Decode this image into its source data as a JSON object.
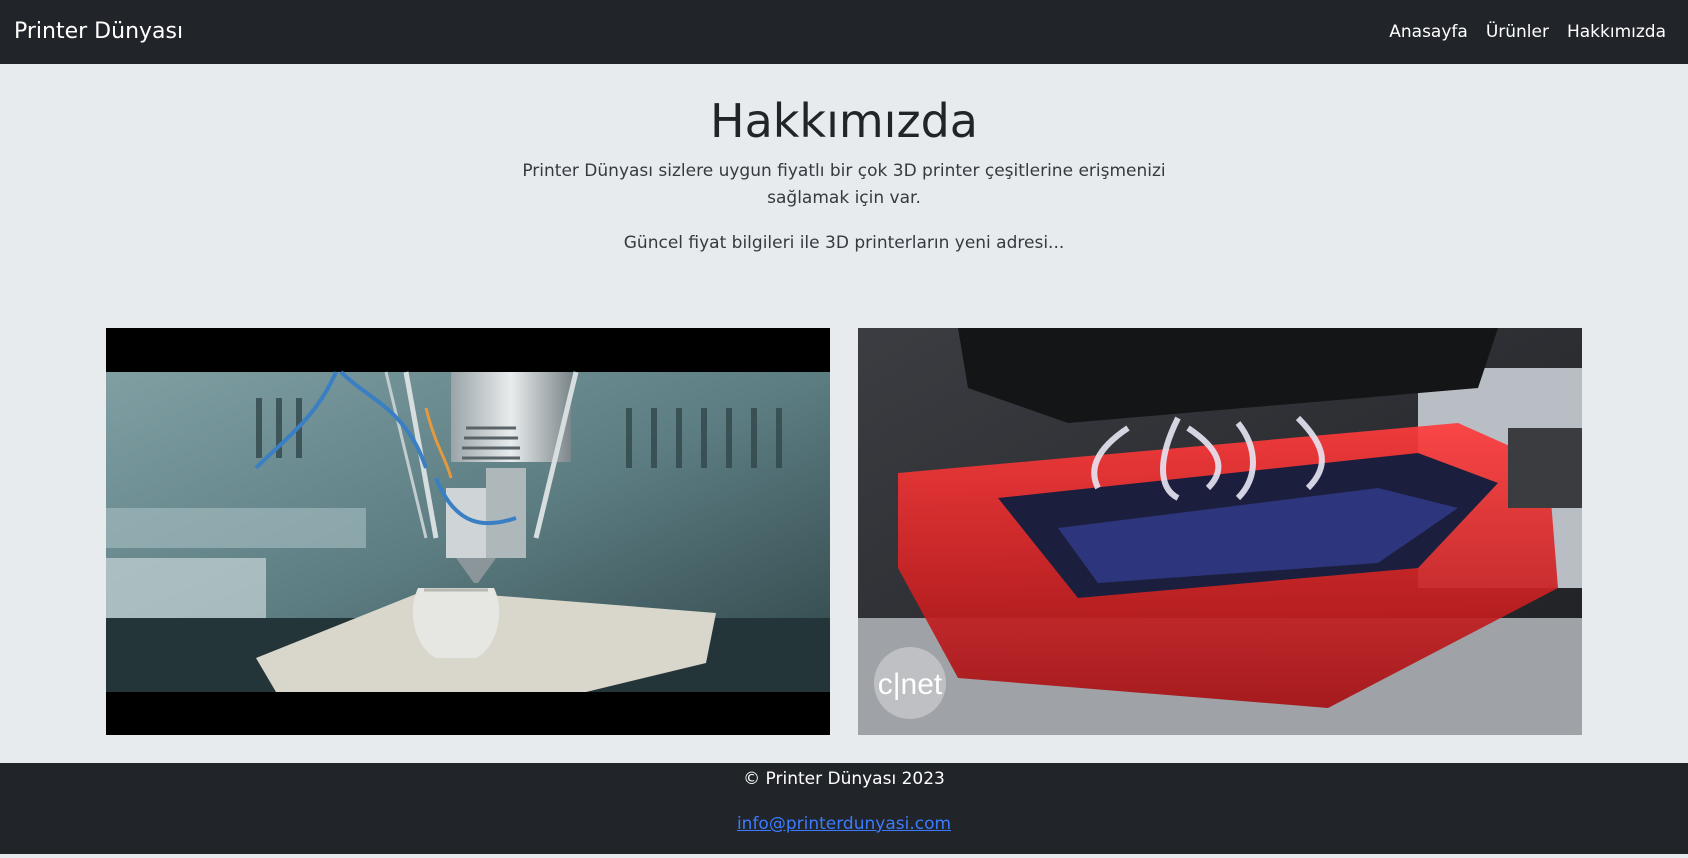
{
  "navbar": {
    "brand": "Printer Dünyası",
    "links": [
      "Anasayfa",
      "Ürünler",
      "Hakkımızda"
    ]
  },
  "about": {
    "title": "Hakkımızda",
    "description": "Printer Dünyası sizlere uygun fiyatlı bir çok 3D printer çeşitlerine erişmenizi sağlamak için var.",
    "subtitle": "Güncel fiyat bilgileri ile 3D printerların yeni adresi..."
  },
  "media": {
    "left_watermark": "",
    "right_watermark": "c|net"
  },
  "footer": {
    "copyright": "© Printer Dünyası 2023",
    "email": "info@printerdunyasi.com"
  },
  "colors": {
    "navbar_bg": "#212529",
    "page_bg": "#e8ebee",
    "link_blue": "#3b7bff"
  }
}
